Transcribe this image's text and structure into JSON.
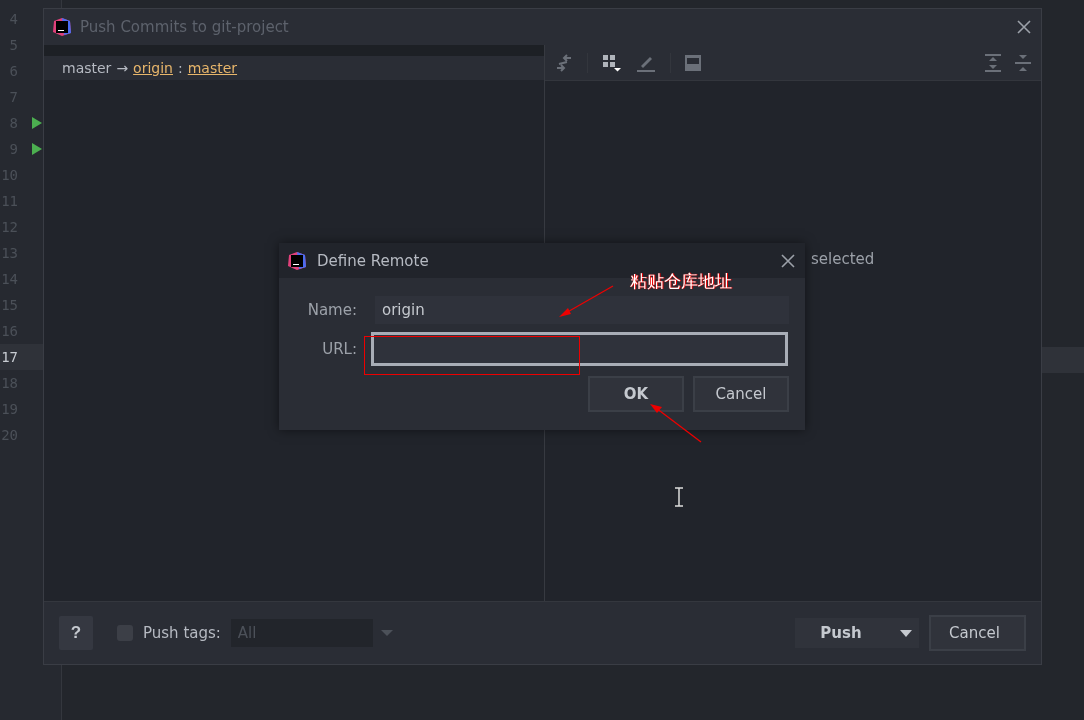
{
  "editor_gutter": {
    "lines": [
      {
        "number": "4",
        "current": false,
        "run_marker": false
      },
      {
        "number": "5",
        "current": false,
        "run_marker": false
      },
      {
        "number": "6",
        "current": false,
        "run_marker": false
      },
      {
        "number": "7",
        "current": false,
        "run_marker": false
      },
      {
        "number": "8",
        "current": false,
        "run_marker": true
      },
      {
        "number": "9",
        "current": false,
        "run_marker": true
      },
      {
        "number": "10",
        "current": false,
        "run_marker": false
      },
      {
        "number": "11",
        "current": false,
        "run_marker": false
      },
      {
        "number": "12",
        "current": false,
        "run_marker": false
      },
      {
        "number": "13",
        "current": false,
        "run_marker": false
      },
      {
        "number": "14",
        "current": false,
        "run_marker": false
      },
      {
        "number": "15",
        "current": false,
        "run_marker": false
      },
      {
        "number": "16",
        "current": false,
        "run_marker": false
      },
      {
        "number": "17",
        "current": true,
        "run_marker": false
      },
      {
        "number": "18",
        "current": false,
        "run_marker": false
      },
      {
        "number": "19",
        "current": false,
        "run_marker": false
      },
      {
        "number": "20",
        "current": false,
        "run_marker": false
      }
    ]
  },
  "push_window": {
    "title": "Push Commits to git-project",
    "branch_row": {
      "local": "master",
      "arrow": "→",
      "remote": "origin",
      "separator": ":",
      "remote_branch": "master"
    },
    "right_panel": {
      "empty_text": "selected"
    },
    "footer": {
      "help": "?",
      "push_tags": {
        "label": "Push tags:",
        "checked": false,
        "dropdown": {
          "value": "All",
          "disabled": true
        }
      },
      "buttons": [
        {
          "label": "Push",
          "kind": "split"
        },
        {
          "label": "Cancel",
          "kind": "plain"
        }
      ]
    }
  },
  "define_remote": {
    "title": "Define Remote",
    "fields": [
      {
        "label": "Name:",
        "value": "origin",
        "focused": false
      },
      {
        "label": "URL:",
        "focused": true
      }
    ],
    "buttons": [
      {
        "label": "OK",
        "default": true
      },
      {
        "label": "Cancel",
        "default": false
      }
    ]
  },
  "annotation": {
    "text": "粘贴仓库地址"
  }
}
